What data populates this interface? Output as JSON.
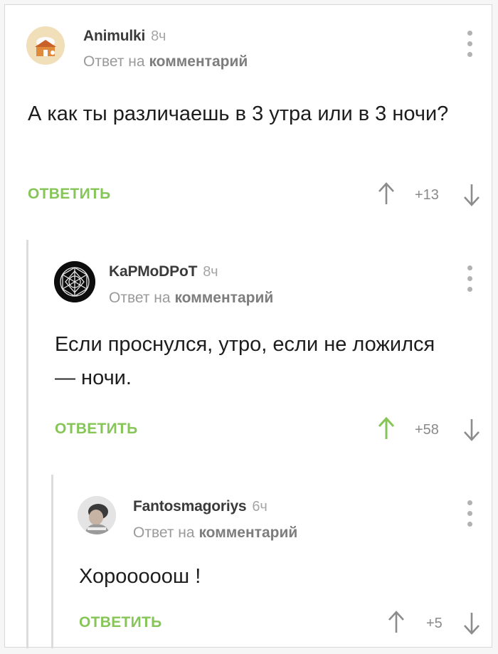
{
  "comments": [
    {
      "author": "Animulki",
      "time": "8ч",
      "reply_prefix": "Ответ на",
      "reply_target": "комментарий",
      "text": "А как ты различаешь в 3 утра или в 3 ночи?",
      "reply_label": "ОТВЕТИТЬ",
      "rating": "+13",
      "upvoted": false,
      "avatar_icon": "house-logo-icon"
    },
    {
      "author": "KaPMoDPoT",
      "time": "8ч",
      "reply_prefix": "Ответ на",
      "reply_target": "комментарий",
      "text": "Если проснулся, утро, если не ложился — ночи.",
      "reply_label": "ОТВЕТИТЬ",
      "rating": "+58",
      "upvoted": true,
      "avatar_icon": "geometric-mandala-icon"
    },
    {
      "author": "Fantosmagoriys",
      "time": "6ч",
      "reply_prefix": "Ответ на",
      "reply_target": "комментарий",
      "text": "Хорооооош !",
      "reply_label": "ОТВЕТИТЬ",
      "rating": "+5",
      "upvoted": false,
      "avatar_icon": "user-photo-avatar"
    }
  ],
  "colors": {
    "accent_green": "#86c557",
    "muted_gray": "#9a9a9a",
    "thread_line": "#dcdcdc"
  }
}
